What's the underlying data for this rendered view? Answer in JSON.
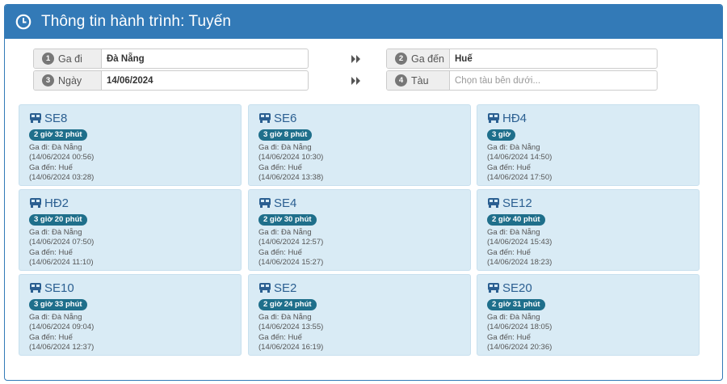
{
  "panel": {
    "title": "Thông tin hành trình: Tuyến"
  },
  "form": {
    "origin": {
      "number": "1",
      "label": "Ga đi",
      "value": "Đà Nẵng"
    },
    "date": {
      "number": "3",
      "label": "Ngày",
      "value": "14/06/2024"
    },
    "destination": {
      "number": "2",
      "label": "Ga đến",
      "value": "Huế"
    },
    "train": {
      "number": "4",
      "label": "Tàu",
      "placeholder": "Chọn tàu bên dưới..."
    }
  },
  "trains": [
    {
      "name": "SE8",
      "duration": "2 giờ 32 phút",
      "depart_label": "Ga đi: Đà Nẵng",
      "depart_time": "(14/06/2024 00:56)",
      "arrive_label": "Ga đến: Huế",
      "arrive_time": "(14/06/2024 03:28)"
    },
    {
      "name": "SE6",
      "duration": "3 giờ 8 phút",
      "depart_label": "Ga đi: Đà Nẵng",
      "depart_time": "(14/06/2024 10:30)",
      "arrive_label": "Ga đến: Huế",
      "arrive_time": "(14/06/2024 13:38)"
    },
    {
      "name": "HĐ4",
      "duration": "3 giờ",
      "depart_label": "Ga đi: Đà Nẵng",
      "depart_time": "(14/06/2024 14:50)",
      "arrive_label": "Ga đến: Huế",
      "arrive_time": "(14/06/2024 17:50)"
    },
    {
      "name": "HĐ2",
      "duration": "3 giờ 20 phút",
      "depart_label": "Ga đi: Đà Nẵng",
      "depart_time": "(14/06/2024 07:50)",
      "arrive_label": "Ga đến: Huế",
      "arrive_time": "(14/06/2024 11:10)"
    },
    {
      "name": "SE4",
      "duration": "2 giờ 30 phút",
      "depart_label": "Ga đi: Đà Nẵng",
      "depart_time": "(14/06/2024 12:57)",
      "arrive_label": "Ga đến: Huế",
      "arrive_time": "(14/06/2024 15:27)"
    },
    {
      "name": "SE12",
      "duration": "2 giờ 40 phút",
      "depart_label": "Ga đi: Đà Nẵng",
      "depart_time": "(14/06/2024 15:43)",
      "arrive_label": "Ga đến: Huế",
      "arrive_time": "(14/06/2024 18:23)"
    },
    {
      "name": "SE10",
      "duration": "3 giờ 33 phút",
      "depart_label": "Ga đi: Đà Nẵng",
      "depart_time": "(14/06/2024 09:04)",
      "arrive_label": "Ga đến: Huế",
      "arrive_time": "(14/06/2024 12:37)"
    },
    {
      "name": "SE2",
      "duration": "2 giờ 24 phút",
      "depart_label": "Ga đi: Đà Nẵng",
      "depart_time": "(14/06/2024 13:55)",
      "arrive_label": "Ga đến: Huế",
      "arrive_time": "(14/06/2024 16:19)"
    },
    {
      "name": "SE20",
      "duration": "2 giờ 31 phút",
      "depart_label": "Ga đi: Đà Nẵng",
      "depart_time": "(14/06/2024 18:05)",
      "arrive_label": "Ga đến: Huế",
      "arrive_time": "(14/06/2024 20:36)"
    }
  ],
  "colors": {
    "primary": "#337ab7",
    "card_bg": "#d9ebf5",
    "badge": "#1f6f8b",
    "train_name": "#2b5f91"
  },
  "icons": {
    "header": "clock-icon",
    "arrow": "double-chevron-right-icon",
    "train": "bus-icon"
  }
}
